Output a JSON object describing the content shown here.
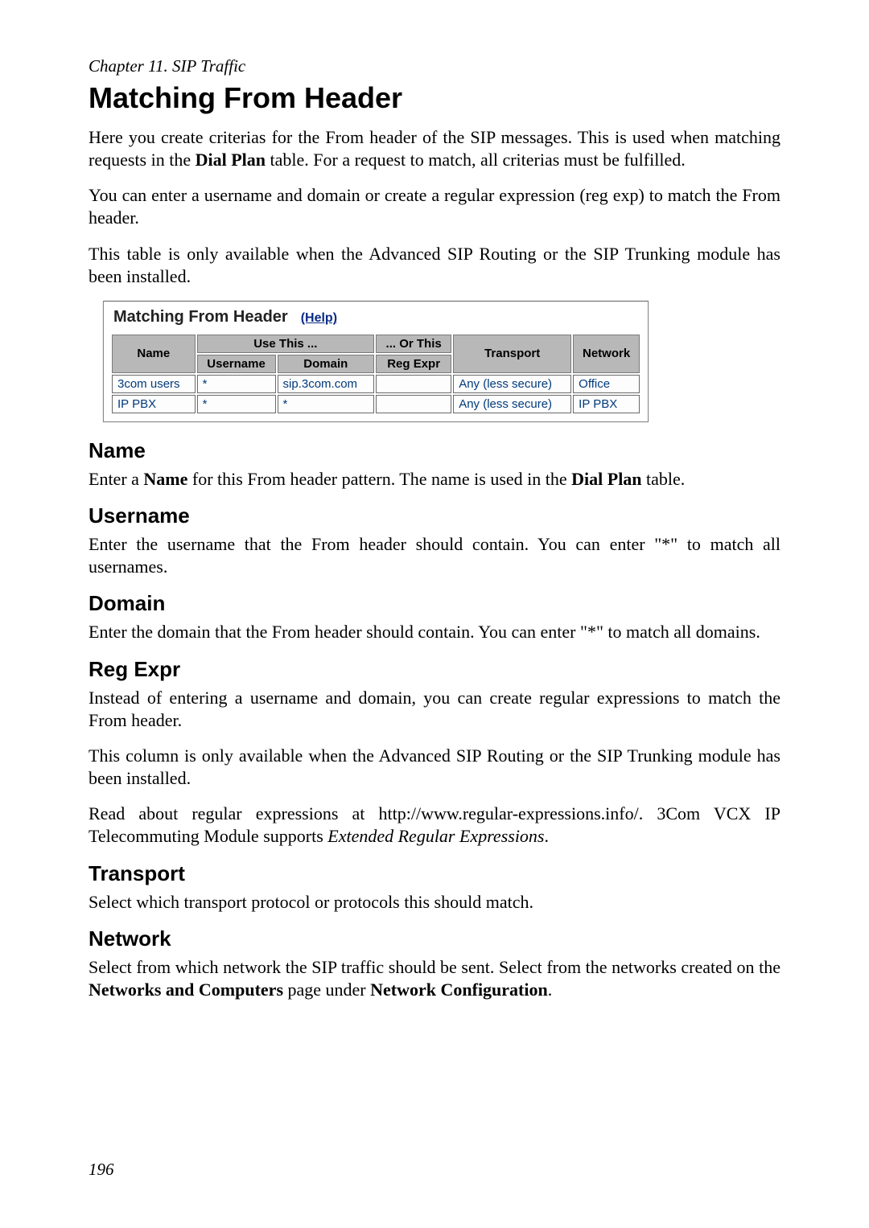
{
  "chapter_line": "Chapter 11. SIP Traffic",
  "page_title": "Matching From Header",
  "page_number": "196",
  "intro": {
    "p1_a": "Here you create criterias for the From header of the SIP messages. This is used when matching requests in the ",
    "p1_b": "Dial Plan",
    "p1_c": " table. For a request to match, all criterias must be fulfilled.",
    "p2": "You can enter a username and domain or create a regular expression (reg exp) to match the From header.",
    "p3": "This table is only available when the Advanced SIP Routing or the SIP Trunking module has been installed."
  },
  "screenshot": {
    "title": "Matching From Header",
    "help_label": "(Help)",
    "header_groups": {
      "name": "Name",
      "use_this": "Use This ...",
      "or_this": "... Or This",
      "transport": "Transport",
      "network": "Network"
    },
    "sub_headers": {
      "username": "Username",
      "domain": "Domain",
      "reg_expr": "Reg Expr"
    },
    "rows": [
      {
        "name": "3com users",
        "username": "*",
        "domain": "sip.3com.com",
        "reg_expr": "",
        "transport": "Any (less secure)",
        "network": "Office"
      },
      {
        "name": "IP PBX",
        "username": "*",
        "domain": "*",
        "reg_expr": "",
        "transport": "Any (less secure)",
        "network": "IP PBX"
      }
    ]
  },
  "sections": {
    "name": {
      "heading": "Name",
      "p1_a": "Enter a ",
      "p1_b": "Name",
      "p1_c": " for this From header pattern. The name is used in the ",
      "p1_d": "Dial Plan",
      "p1_e": " table."
    },
    "username": {
      "heading": "Username",
      "p1": "Enter the username that the From header should contain. You can enter \"*\" to match all usernames."
    },
    "domain": {
      "heading": "Domain",
      "p1": "Enter the domain that the From header should contain. You can enter \"*\" to match all domains."
    },
    "reg_expr": {
      "heading": "Reg Expr",
      "p1": "Instead of entering a username and domain, you can create regular expressions to match the From header.",
      "p2": "This column is only available when the Advanced SIP Routing or the SIP Trunking module has been installed.",
      "p3_a": "Read about regular expressions at http://www.regular-expressions.info/. 3Com VCX IP Telecommuting Module supports ",
      "p3_b": "Extended Regular Expressions",
      "p3_c": "."
    },
    "transport": {
      "heading": "Transport",
      "p1": "Select which transport protocol or protocols this should match."
    },
    "network": {
      "heading": "Network",
      "p1_a": "Select from which network the SIP traffic should be sent. Select from the networks created on the ",
      "p1_b": "Networks and Computers",
      "p1_c": " page under ",
      "p1_d": "Network Configuration",
      "p1_e": "."
    }
  }
}
